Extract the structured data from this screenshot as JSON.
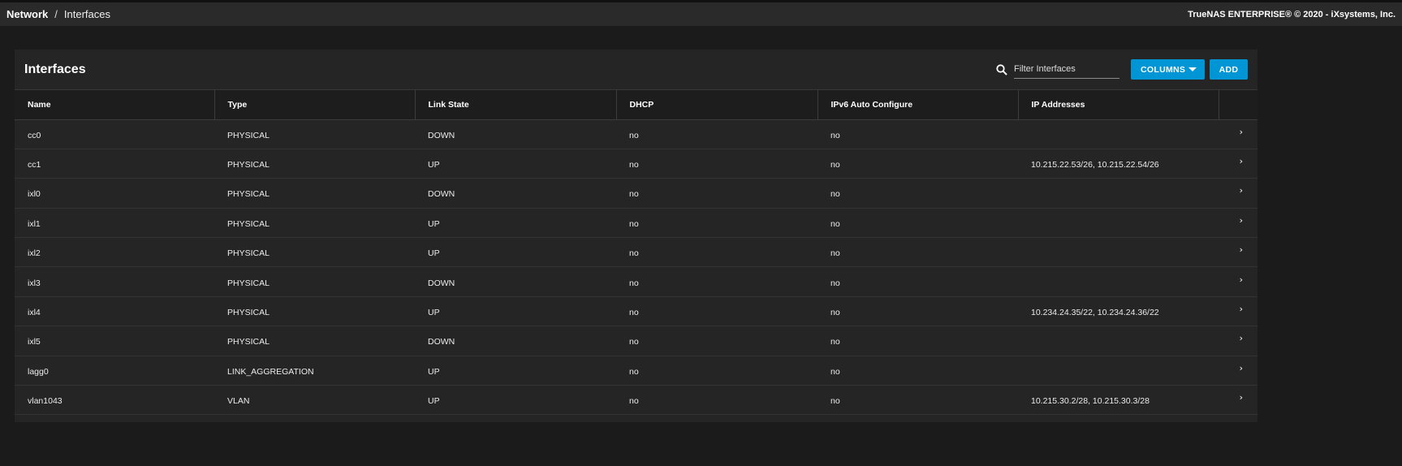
{
  "breadcrumb": {
    "root": "Network",
    "separator": "/",
    "current": "Interfaces"
  },
  "copyright": "TrueNAS ENTERPRISE® © 2020 - iXsystems, Inc.",
  "card": {
    "title": "Interfaces",
    "filter_placeholder": "Filter Interfaces",
    "columns_button": "COLUMNS",
    "add_button": "ADD"
  },
  "colors": {
    "accent": "#0095d5",
    "background": "#1b1b1b",
    "card": "#252525"
  },
  "table": {
    "headers": [
      "Name",
      "Type",
      "Link State",
      "DHCP",
      "IPv6 Auto Configure",
      "IP Addresses"
    ],
    "rows": [
      [
        "cc0",
        "PHYSICAL",
        "DOWN",
        "no",
        "no",
        ""
      ],
      [
        "cc1",
        "PHYSICAL",
        "UP",
        "no",
        "no",
        "10.215.22.53/26, 10.215.22.54/26"
      ],
      [
        "ixl0",
        "PHYSICAL",
        "DOWN",
        "no",
        "no",
        ""
      ],
      [
        "ixl1",
        "PHYSICAL",
        "UP",
        "no",
        "no",
        ""
      ],
      [
        "ixl2",
        "PHYSICAL",
        "UP",
        "no",
        "no",
        ""
      ],
      [
        "ixl3",
        "PHYSICAL",
        "DOWN",
        "no",
        "no",
        ""
      ],
      [
        "ixl4",
        "PHYSICAL",
        "UP",
        "no",
        "no",
        "10.234.24.35/22, 10.234.24.36/22"
      ],
      [
        "ixl5",
        "PHYSICAL",
        "DOWN",
        "no",
        "no",
        ""
      ],
      [
        "lagg0",
        "LINK_AGGREGATION",
        "UP",
        "no",
        "no",
        ""
      ],
      [
        "vlan1043",
        "VLAN",
        "UP",
        "no",
        "no",
        "10.215.30.2/28, 10.215.30.3/28"
      ]
    ]
  }
}
